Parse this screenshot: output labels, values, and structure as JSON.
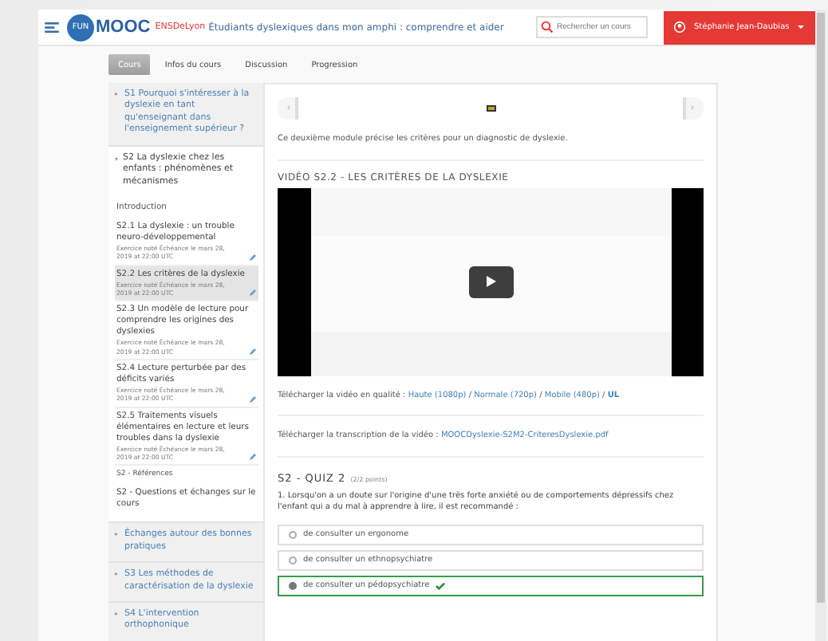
{
  "header": {
    "logo_badge": "FUN",
    "logo_text": "MOOC",
    "organization": "ENSDeLyon",
    "course_title": "Étudiants dyslexiques dans mon amphi : comprendre et aider",
    "search": {
      "placeholder": "Rechercher un cours"
    },
    "user": "Stéphanie Jean-Daubias"
  },
  "tabs": [
    {
      "label": "Cours",
      "selected": true
    },
    {
      "label": "Infos du cours",
      "selected": false
    },
    {
      "label": "Discussion",
      "selected": false
    },
    {
      "label": "Progression",
      "selected": false
    }
  ],
  "sidebar": {
    "sections": [
      {
        "title": "S1 Pourquoi s'intéresser à la dyslexie en tant qu'enseignant dans l'enseignement supérieur ?",
        "expanded": false
      },
      {
        "title": "S2 La dyslexie chez les enfants : phénomènes et mécanismes",
        "expanded": true,
        "children": [
          {
            "kind": "heading",
            "title": "Introduction",
            "selected": false
          },
          {
            "kind": "graded",
            "title": "S2.1 La dyslexie : un trouble neuro-développemental",
            "due": "Exercice noté Échéance le mars 28, 2019 at 22:00 UTC",
            "selected": false
          },
          {
            "kind": "graded",
            "title": "S2.2 Les critères de la dyslexie",
            "due": "Exercice noté Échéance le mars 28, 2019 at 22:00 UTC",
            "selected": true
          },
          {
            "kind": "graded",
            "title": "S2.3 Un modèle de lecture pour comprendre les origines des dyslexies",
            "due": "Exercice noté Échéance le mars 28, 2019 at 22:00 UTC",
            "selected": false
          },
          {
            "kind": "graded",
            "title": "S2.4 Lecture perturbée par des déficits variés",
            "due": "Exercice noté Échéance le mars 28, 2019 at 22:00 UTC",
            "selected": false
          },
          {
            "kind": "graded",
            "title": "S2.5 Traitements visuels élémentaires en lecture et leurs troubles dans la dyslexie",
            "due": "Exercice noté Échéance le mars 28, 2019 at 22:00 UTC",
            "selected": false
          },
          {
            "kind": "small",
            "title": "S2 - Références",
            "selected": false
          },
          {
            "kind": "plain",
            "title": "S2 - Questions et échanges sur le cours",
            "selected": false
          }
        ]
      },
      {
        "title": "Échanges autour des bonnes pratiques",
        "expanded": false
      },
      {
        "title": "S3 Les méthodes de caractérisation de la dyslexie",
        "expanded": false
      },
      {
        "title": "S4 L'intervention orthophonique",
        "expanded": false
      }
    ]
  },
  "content": {
    "nav": {
      "prev": "‹",
      "next": "›"
    },
    "intro": "Ce deuxième module précise les critères pour un diagnostic de dyslexie.",
    "video_heading": "VIDÉO S2.2 - LES CRITÈRES DE LA DYSLEXIE",
    "download": {
      "label": "Télécharger la vidéo en qualité : ",
      "links": [
        "Haute (1080p)",
        "Normale (720p)",
        "Mobile (480p)",
        "UL"
      ],
      "separator": " / "
    },
    "transcript": {
      "label": "Télécharger la transcription de la vidéo : ",
      "link": "MOOCDyslexie-S2M2-CriteresDyslexie.pdf"
    },
    "quiz": {
      "title": "S2 - QUIZ 2",
      "points": "(2/2 points)",
      "question": "1. Lorsqu'on a un doute sur l'origine d'une très forte anxiété ou de comportements dépressifs chez l'enfant qui a du mal à apprendre à lire, il est recommandé :",
      "options": [
        {
          "label": "de consulter un ergonome",
          "selected": false
        },
        {
          "label": "de consulter un ethnopsychiatre",
          "selected": false
        },
        {
          "label": "de consulter un pédopsychiatre",
          "selected": true
        }
      ]
    }
  }
}
